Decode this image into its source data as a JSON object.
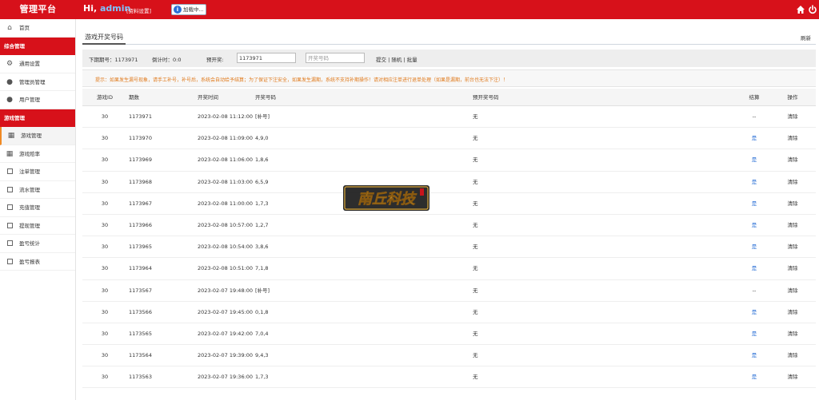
{
  "header": {
    "brand": "管理平台",
    "greeting": "Hi,",
    "username": "admin",
    "profile_link": "[资料设置]",
    "loading_label": "加载中..."
  },
  "sidebar": {
    "items": [
      {
        "type": "item",
        "label": "首页",
        "icon": "home-icon"
      },
      {
        "type": "head",
        "label": "综合管理"
      },
      {
        "type": "item",
        "label": "通用设置",
        "icon": "gear-icon"
      },
      {
        "type": "item",
        "label": "管理员管理",
        "icon": "user-icon"
      },
      {
        "type": "item",
        "label": "用户管理",
        "icon": "user-icon"
      },
      {
        "type": "head",
        "label": "游戏管理"
      },
      {
        "type": "item",
        "label": "游戏管理",
        "icon": "game-icon",
        "active": true
      },
      {
        "type": "item",
        "label": "游戏赔率",
        "icon": "game-icon"
      },
      {
        "type": "item",
        "label": "注单管理",
        "icon": "square-icon"
      },
      {
        "type": "item",
        "label": "流水管理",
        "icon": "square-icon"
      },
      {
        "type": "item",
        "label": "充值管理",
        "icon": "square-icon"
      },
      {
        "type": "item",
        "label": "提现管理",
        "icon": "square-icon"
      },
      {
        "type": "item",
        "label": "盈亏统计",
        "icon": "square-icon"
      },
      {
        "type": "item",
        "label": "盈亏报表",
        "icon": "square-icon"
      }
    ]
  },
  "main": {
    "tab_label": "游戏开奖号码",
    "refresh_label": "刷新",
    "controls": {
      "next_issue": "下期期号：1173971",
      "countdown": "倒计时：0:0",
      "preset_label": "预开奖:",
      "issue_value": "1173971",
      "code_placeholder": "开奖号码",
      "actions": "提交 | 随机 | 批量"
    },
    "notice": "提示：如果发生漏号现象，请手工补号，补号后，系统会自动给予结算；为了保证下注安全，如果发生漏期，系统不支持补期操作！请对相应注单进行退单处理（如果是漏期，前台也无法下注）！",
    "columns": {
      "id": "游戏ID",
      "issue": "期数",
      "time": "开奖时间",
      "code": "开奖号码",
      "preset": "预开奖号码",
      "settle": "结算",
      "ops": "操作"
    },
    "rows": [
      {
        "id": "30",
        "issue": "1173971",
        "time": "2023-02-08 11:12:00",
        "code": "[补号]",
        "preset": "无",
        "settle": "--",
        "op": "清除"
      },
      {
        "id": "30",
        "issue": "1173970",
        "time": "2023-02-08 11:09:00",
        "code": "4,9,0",
        "preset": "无",
        "settle": "是",
        "op": "清除"
      },
      {
        "id": "30",
        "issue": "1173969",
        "time": "2023-02-08 11:06:00",
        "code": "1,8,6",
        "preset": "无",
        "settle": "是",
        "op": "清除"
      },
      {
        "id": "30",
        "issue": "1173968",
        "time": "2023-02-08 11:03:00",
        "code": "6,5,9",
        "preset": "无",
        "settle": "是",
        "op": "清除"
      },
      {
        "id": "30",
        "issue": "1173967",
        "time": "2023-02-08 11:00:00",
        "code": "1,7,3",
        "preset": "无",
        "settle": "是",
        "op": "清除"
      },
      {
        "id": "30",
        "issue": "1173966",
        "time": "2023-02-08 10:57:00",
        "code": "1,2,7",
        "preset": "无",
        "settle": "是",
        "op": "清除"
      },
      {
        "id": "30",
        "issue": "1173965",
        "time": "2023-02-08 10:54:00",
        "code": "3,8,6",
        "preset": "无",
        "settle": "是",
        "op": "清除"
      },
      {
        "id": "30",
        "issue": "1173964",
        "time": "2023-02-08 10:51:00",
        "code": "7,1,8",
        "preset": "无",
        "settle": "是",
        "op": "清除"
      },
      {
        "id": "30",
        "issue": "1173567",
        "time": "2023-02-07 19:48:00",
        "code": "[补号]",
        "preset": "无",
        "settle": "--",
        "op": "清除"
      },
      {
        "id": "30",
        "issue": "1173566",
        "time": "2023-02-07 19:45:00",
        "code": "0,1,8",
        "preset": "无",
        "settle": "是",
        "op": "清除"
      },
      {
        "id": "30",
        "issue": "1173565",
        "time": "2023-02-07 19:42:00",
        "code": "7,0,4",
        "preset": "无",
        "settle": "是",
        "op": "清除"
      },
      {
        "id": "30",
        "issue": "1173564",
        "time": "2023-02-07 19:39:00",
        "code": "9,4,3",
        "preset": "无",
        "settle": "是",
        "op": "清除"
      },
      {
        "id": "30",
        "issue": "1173563",
        "time": "2023-02-07 19:36:00",
        "code": "1,7,3",
        "preset": "无",
        "settle": "是",
        "op": "清除"
      }
    ]
  },
  "watermark": {
    "text": "南丘科技"
  },
  "colors": {
    "brand_red": "#d7111a",
    "link_blue": "#2a6fd6",
    "notice_orange": "#e07a1c",
    "active_orange": "#f08a24"
  }
}
